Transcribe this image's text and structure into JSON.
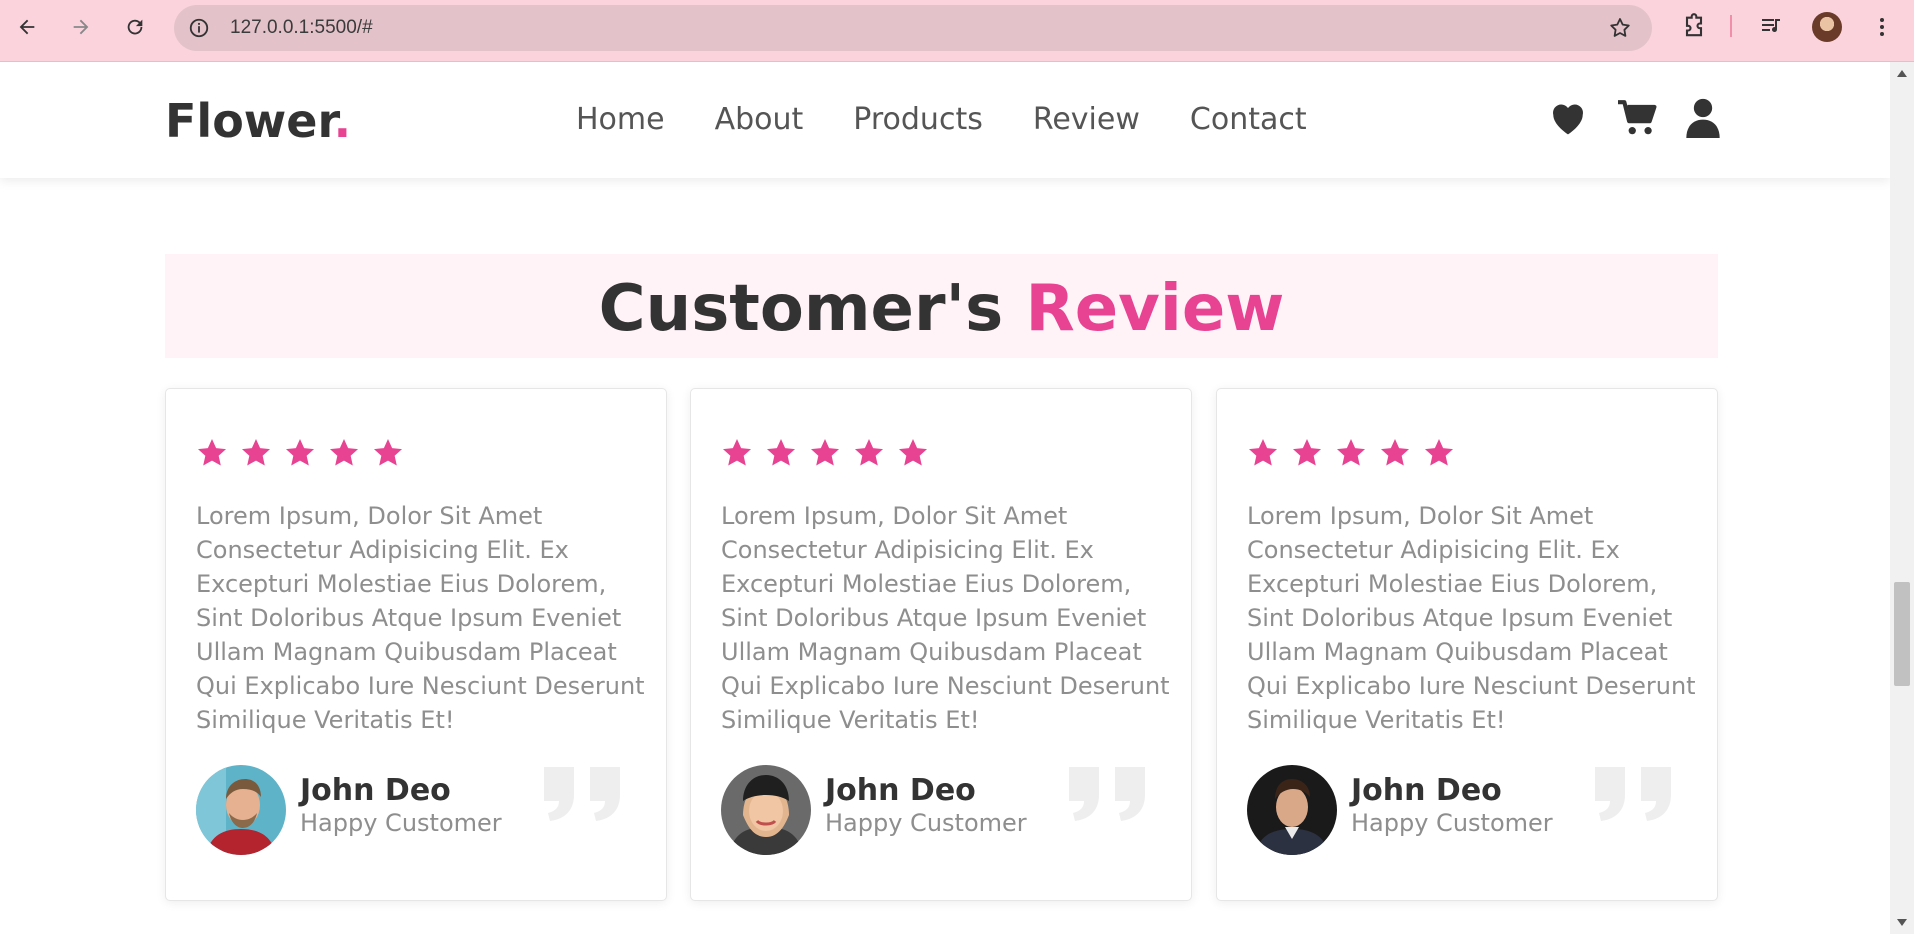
{
  "browser": {
    "url": "127.0.0.1:5500/#",
    "back_icon": "arrow-left-icon",
    "forward_icon": "arrow-right-icon",
    "reload_icon": "reload-icon",
    "bookmark_icon": "star-outline-icon"
  },
  "header": {
    "logo_text": "Flower",
    "logo_dot": ".",
    "nav": [
      "Home",
      "About",
      "Products",
      "Review",
      "Contact"
    ],
    "icons": [
      "heart-icon",
      "cart-icon",
      "user-icon"
    ]
  },
  "section": {
    "title_main": "Customer's",
    "title_accent": "Review"
  },
  "reviews": [
    {
      "rating": 5,
      "text": "Lorem Ipsum, Dolor Sit Amet Consectetur Adipisicing Elit. Ex Excepturi Molestiae Eius Dolorem, Sint Doloribus Atque Ipsum Eveniet Ullam Magnam Quibusdam Placeat Qui Explicabo Iure Nesciunt Deserunt Similique Veritatis Et!",
      "name": "John Deo",
      "role": "Happy Customer"
    },
    {
      "rating": 5,
      "text": "Lorem Ipsum, Dolor Sit Amet Consectetur Adipisicing Elit. Ex Excepturi Molestiae Eius Dolorem, Sint Doloribus Atque Ipsum Eveniet Ullam Magnam Quibusdam Placeat Qui Explicabo Iure Nesciunt Deserunt Similique Veritatis Et!",
      "name": "John Deo",
      "role": "Happy Customer"
    },
    {
      "rating": 5,
      "text": "Lorem Ipsum, Dolor Sit Amet Consectetur Adipisicing Elit. Ex Excepturi Molestiae Eius Dolorem, Sint Doloribus Atque Ipsum Eveniet Ullam Magnam Quibusdam Placeat Qui Explicabo Iure Nesciunt Deserunt Similique Veritatis Et!",
      "name": "John Deo",
      "role": "Happy Customer"
    }
  ],
  "colors": {
    "accent": "#e84393",
    "heading_band": "#fff3f8",
    "chrome": "#fbd3dd"
  }
}
